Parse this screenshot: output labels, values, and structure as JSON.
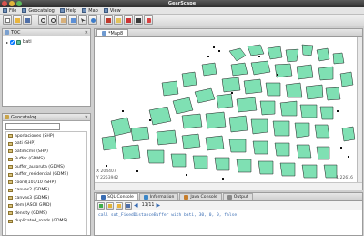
{
  "window": {
    "title": "GearScape"
  },
  "menu": [
    {
      "label": "File"
    },
    {
      "label": "Geocatalog"
    },
    {
      "label": "Help"
    },
    {
      "label": "Map"
    },
    {
      "label": "View"
    }
  ],
  "toc": {
    "title": "TOC",
    "layer": "bati"
  },
  "geocatalog": {
    "title": "Geocatalog",
    "search_value": "",
    "items": [
      "aporlaciones (SHP)",
      "bati (SHP)",
      "batimcms (SHP)",
      "Buffer (GDMS)",
      "buffer_autoruta (GDMS)",
      "buffer_residential (GDMS)",
      "coord(101/10 (SHP)",
      "canvas2 (GDMS)",
      "canvas3 (GDMS)",
      "dem (ASCII GRID)",
      "density (GDMS)",
      "duplicated_roads (GDMS)"
    ]
  },
  "map": {
    "tab_label": "*Map8",
    "coord_x": "X 204407",
    "coord_y": "Y 2253942",
    "scale": "1:22616"
  },
  "console": {
    "tabs": [
      {
        "label": "SQL Console"
      },
      {
        "label": "Information"
      },
      {
        "label": "Java Console"
      },
      {
        "label": "Output"
      }
    ],
    "page": "11/11",
    "command": "call sot_FixedDistanceBuffer with bati, 30, 0, 0, false;"
  }
}
